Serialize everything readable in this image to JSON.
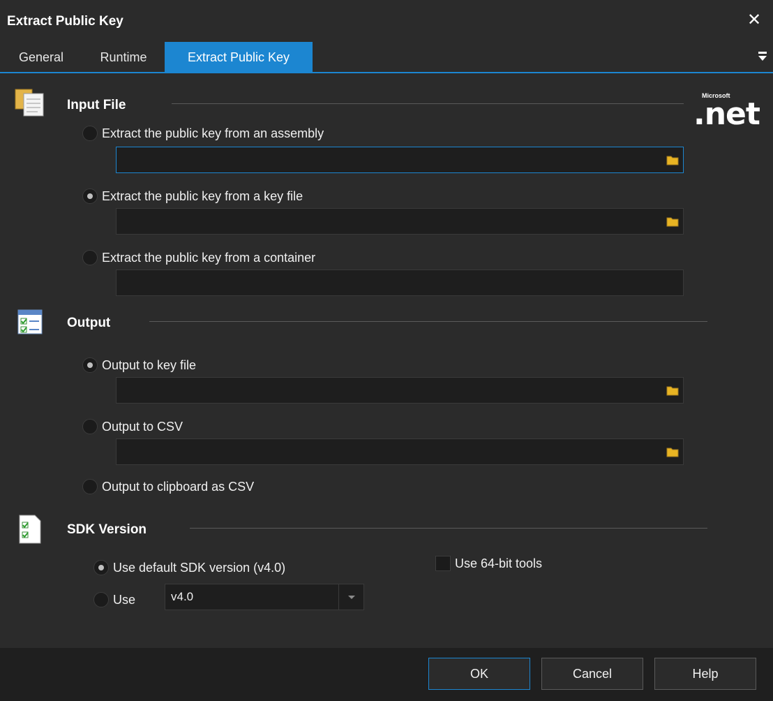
{
  "window": {
    "title": "Extract Public Key",
    "close_label": "✕"
  },
  "tabs": [
    {
      "label": "General"
    },
    {
      "label": "Runtime"
    },
    {
      "label": "Extract Public Key",
      "active": true
    }
  ],
  "logo": {
    "text": ".net",
    "small_text": "Microsoft"
  },
  "input_file": {
    "title": "Input File",
    "options": [
      {
        "label": "Extract the public key from an assembly",
        "checked": false,
        "value": ""
      },
      {
        "label": "Extract the public key from a key file",
        "checked": true,
        "value": ""
      },
      {
        "label": "Extract the public key from a container",
        "checked": false,
        "value": ""
      }
    ]
  },
  "output": {
    "title": "Output",
    "options": [
      {
        "label": "Output to key file",
        "checked": true,
        "value": ""
      },
      {
        "label": "Output to CSV",
        "checked": false,
        "value": ""
      },
      {
        "label": "Output to clipboard as CSV",
        "checked": false
      }
    ]
  },
  "sdk_version": {
    "title": "SDK Version",
    "default_label": "Use default SDK version (v4.0)",
    "default_checked": true,
    "use_label": "Use",
    "use_checked": false,
    "selected_version": "v4.0",
    "use_64bit_label": "Use 64-bit tools",
    "use_64bit_checked": false
  },
  "footer": {
    "ok_label": "OK",
    "cancel_label": "Cancel",
    "help_label": "Help"
  },
  "colors": {
    "accent": "#1c86d1",
    "background": "#2b2b2b",
    "field": "#1e1e1e",
    "folder": "#e8b423"
  }
}
